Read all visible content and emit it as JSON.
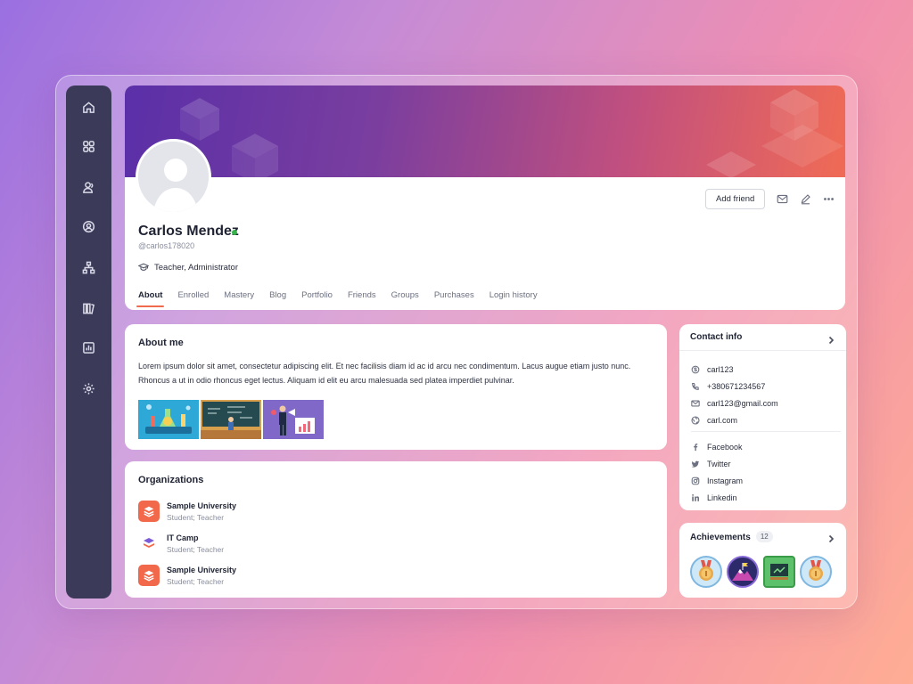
{
  "sidebar": {
    "items": [
      {
        "name": "home-icon"
      },
      {
        "name": "apps-grid-icon"
      },
      {
        "name": "users-icon"
      },
      {
        "name": "profile-circle-icon"
      },
      {
        "name": "hierarchy-icon"
      },
      {
        "name": "library-icon"
      },
      {
        "name": "reports-chart-icon"
      },
      {
        "name": "settings-gear-icon"
      }
    ]
  },
  "profile": {
    "name": "Carlos Mendez",
    "username": "@carlos178020",
    "role": "Teacher, Administrator",
    "online_color": "#35b34a",
    "add_friend_label": "Add friend",
    "tabs": [
      "About",
      "Enrolled",
      "Mastery",
      "Blog",
      "Portfolio",
      "Friends",
      "Groups",
      "Purchases",
      "Login history"
    ],
    "active_tab": "About"
  },
  "about": {
    "title": "About me",
    "text": "Lorem ipsum dolor sit amet, consectetur adipiscing elit. Et nec facilisis diam id ac id arcu nec condimentum. Lacus augue etiam justo nunc. Rhoncus a ut in odio rhoncus eget lectus. Aliquam id elit eu arcu malesuada sed platea imperdiet pulvinar."
  },
  "organizations": {
    "title": "Organizations",
    "items": [
      {
        "name": "Sample University",
        "role": "Student; Teacher"
      },
      {
        "name": "IT Camp",
        "role": "Student; Teacher"
      },
      {
        "name": "Sample University",
        "role": "Student; Teacher"
      }
    ]
  },
  "contact": {
    "title": "Contact info",
    "items": [
      {
        "icon": "skype-icon",
        "value": "carl123"
      },
      {
        "icon": "phone-icon",
        "value": "+380671234567"
      },
      {
        "icon": "mail-icon",
        "value": "carl123@gmail.com"
      },
      {
        "icon": "globe-icon",
        "value": "carl.com"
      }
    ],
    "social": [
      {
        "icon": "facebook-icon",
        "value": "Facebook"
      },
      {
        "icon": "twitter-icon",
        "value": "Twitter"
      },
      {
        "icon": "instagram-icon",
        "value": "Instagram"
      },
      {
        "icon": "linkedin-icon",
        "value": "Linkedin"
      }
    ]
  },
  "achievements": {
    "title": "Achievements",
    "count": "12",
    "items": [
      {
        "name": "bronze-medal-icon"
      },
      {
        "name": "mountain-flag-icon"
      },
      {
        "name": "presentation-board-icon"
      },
      {
        "name": "bronze-medal-icon"
      }
    ]
  },
  "colors": {
    "accent": "#f06a4e",
    "sidebar": "#3b3a58"
  }
}
